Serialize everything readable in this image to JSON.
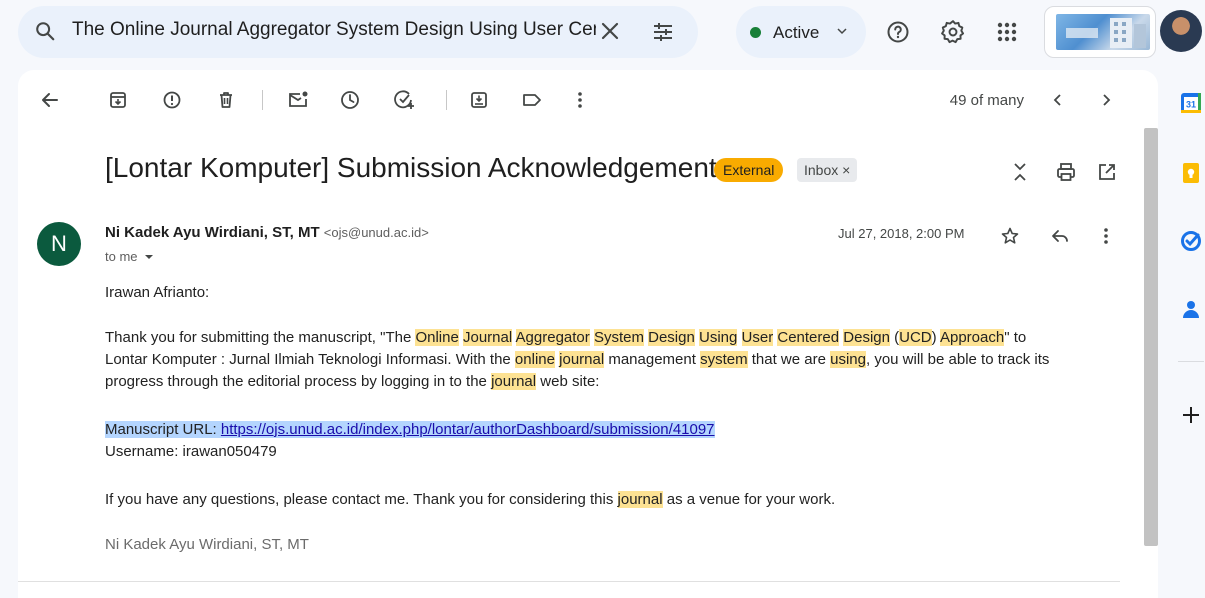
{
  "search": {
    "query": "The Online Journal Aggregator System Design Using User Centered Design"
  },
  "status": {
    "label": "Active",
    "color": "#188038"
  },
  "toolbar": {
    "pagination": "49 of many"
  },
  "message": {
    "subject": "[Lontar Komputer] Submission Acknowledgement",
    "labels": {
      "external": "External",
      "inbox": "Inbox",
      "inbox_close": "×"
    },
    "sender": {
      "initial": "N",
      "name": "Ni Kadek Ayu Wirdiani, ST, MT",
      "email": "<ojs@unud.ac.id>"
    },
    "recipient": "to me",
    "date": "Jul 27, 2018, 2:00 PM",
    "body": {
      "greeting": "Irawan Afrianto:",
      "p1_l1": [
        {
          "t": "Thank you for submitting the manuscript, \"The ",
          "h": false
        },
        {
          "t": "Online",
          "h": true
        },
        {
          "t": " ",
          "h": false
        },
        {
          "t": "Journal",
          "h": true
        },
        {
          "t": " ",
          "h": false
        },
        {
          "t": "Aggregator",
          "h": true
        },
        {
          "t": " ",
          "h": false
        },
        {
          "t": "System",
          "h": true
        },
        {
          "t": " ",
          "h": false
        },
        {
          "t": "Design",
          "h": true
        },
        {
          "t": " ",
          "h": false
        },
        {
          "t": "Using",
          "h": true
        },
        {
          "t": " ",
          "h": false
        },
        {
          "t": "User",
          "h": true
        },
        {
          "t": " ",
          "h": false
        },
        {
          "t": "Centered",
          "h": true
        },
        {
          "t": " ",
          "h": false
        },
        {
          "t": "Design",
          "h": true
        },
        {
          "t": " (",
          "h": false
        },
        {
          "t": "UCD",
          "h": true
        },
        {
          "t": ") ",
          "h": false
        },
        {
          "t": "Approach",
          "h": true
        },
        {
          "t": "\" to",
          "h": false
        }
      ],
      "p1_l2": [
        {
          "t": "Lontar Komputer : Jurnal Ilmiah Teknologi Informasi. With the ",
          "h": false
        },
        {
          "t": "online",
          "h": true
        },
        {
          "t": " ",
          "h": false
        },
        {
          "t": "journal",
          "h": true
        },
        {
          "t": " management ",
          "h": false
        },
        {
          "t": "system",
          "h": true
        },
        {
          "t": " that we are ",
          "h": false
        },
        {
          "t": "using",
          "h": true
        },
        {
          "t": ", you will be able to track its",
          "h": false
        }
      ],
      "p1_l3": [
        {
          "t": "progress through the editorial process by logging in to the ",
          "h": false
        },
        {
          "t": "journal",
          "h": true
        },
        {
          "t": " web site:",
          "h": false
        }
      ],
      "url_label": "Manuscript URL: ",
      "url": "https://ojs.unud.ac.id/index.php/lontar/authorDashboard/submission/41097",
      "username": "Username: irawan050479",
      "p3": [
        {
          "t": "If you have any questions, please contact me. Thank you for considering this ",
          "h": false
        },
        {
          "t": "journal",
          "h": true
        },
        {
          "t": " as a venue for your work.",
          "h": false
        }
      ],
      "signature": "Ni Kadek Ayu Wirdiani, ST, MT"
    }
  },
  "rail": {
    "calendar_day": "31"
  }
}
